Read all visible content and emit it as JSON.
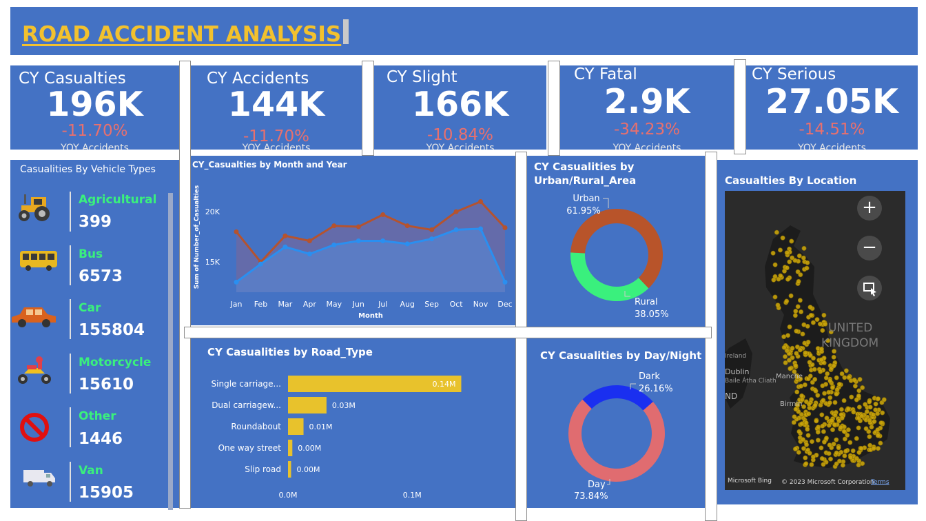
{
  "header": {
    "title": "ROAD ACCIDENT ANALYSIS"
  },
  "kpis": [
    {
      "label": "CY Casualties",
      "value": "196K",
      "change": "-11.70%",
      "sub": "YOY Accidents"
    },
    {
      "label": "CY Accidents",
      "value": "144K",
      "change": "-11.70%",
      "sub": "YOY Accidents"
    },
    {
      "label": "CY Slight",
      "value": "166K",
      "change": "-10.84%",
      "sub": "YOY Accidents"
    },
    {
      "label": "CY Fatal",
      "value": "2.9K",
      "change": "-34.23%",
      "sub": "YOY Accidents"
    },
    {
      "label": "CY Serious",
      "value": "27.05K",
      "change": "-14.51%",
      "sub": "YOY Accidents"
    }
  ],
  "vehicle_types": {
    "title": "Casualities By Vehicle Types",
    "items": [
      {
        "name": "Agricultural",
        "value": "399",
        "icon": "tractor-icon"
      },
      {
        "name": "Bus",
        "value": "6573",
        "icon": "bus-icon"
      },
      {
        "name": "Car",
        "value": "155804",
        "icon": "car-icon"
      },
      {
        "name": "Motorcycle",
        "value": "15610",
        "icon": "motorcycle-icon"
      },
      {
        "name": "Other",
        "value": "1446",
        "icon": "prohibited-icon"
      },
      {
        "name": "Van",
        "value": "15905",
        "icon": "van-icon"
      }
    ]
  },
  "map": {
    "title": "Casualties By Location",
    "label_country": "UNITED",
    "label_country2": "KINGDOM",
    "labels": [
      "Ireland",
      "Dublin",
      "Baile Átha Cliath",
      "ND",
      "Manche",
      "Birmin"
    ],
    "attribution_left": "Microsoft Bing",
    "attribution_right": "© 2023 Microsoft Corporation",
    "terms": "Terms"
  },
  "colors": {
    "panel": "#4472c4",
    "title": "#f2c12e",
    "negative": "#e8706e",
    "vehicle_name": "#3af07d",
    "line_prev": "#b5532e",
    "line_cur": "#2a8ff0",
    "urban": "#b8542a",
    "rural": "#3af07d",
    "day": "#e06c70",
    "dark": "#1a2ff0",
    "bar": "#e8c22c"
  },
  "chart_data": [
    {
      "type": "area",
      "title": "CY_Casualties by Month and Year",
      "xlabel": "Month",
      "ylabel": "Sum of Number_of_Casualties",
      "categories": [
        "Jan",
        "Feb",
        "Mar",
        "Apr",
        "May",
        "Jun",
        "Jul",
        "Aug",
        "Sep",
        "Oct",
        "Nov",
        "Dec"
      ],
      "yticks": [
        "20K",
        "15K"
      ],
      "ylim": [
        12000,
        23500
      ],
      "series": [
        {
          "values": [
            18000,
            15000,
            17600,
            17100,
            18600,
            18500,
            19700,
            18600,
            18200,
            20000,
            21000,
            18400
          ]
        },
        {
          "values": [
            13000,
            14800,
            16500,
            15800,
            16700,
            17100,
            17100,
            16800,
            17300,
            18200,
            18300,
            13000
          ]
        }
      ]
    },
    {
      "type": "pie",
      "title": "CY Casualities by Urban/Rural_Area",
      "categories": [
        "Urban",
        "Rural"
      ],
      "values": [
        61.95,
        38.05
      ],
      "labels": [
        "61.95%",
        "38.05%"
      ]
    },
    {
      "type": "bar",
      "title": "CY Casualities by Road_Type",
      "categories": [
        "Single carriage...",
        "Dual carriagew...",
        "Roundabout",
        "One way street",
        "Slip road"
      ],
      "values": [
        0.14,
        0.03,
        0.01,
        0.0,
        0.0
      ],
      "bar_values": [
        0.1395,
        0.031,
        0.0125,
        0.0035,
        0.0025
      ],
      "value_labels": [
        "0.14M",
        "0.03M",
        "0.01M",
        "0.00M",
        "0.00M"
      ],
      "xticks": [
        "0.0M",
        "0.1M"
      ],
      "xlim": [
        0,
        0.147
      ]
    },
    {
      "type": "pie",
      "title": "CY Casualities by Day/Night",
      "categories": [
        "Dark",
        "Day"
      ],
      "values": [
        26.16,
        73.84
      ],
      "labels": [
        "26.16%",
        "73.84%"
      ]
    }
  ]
}
